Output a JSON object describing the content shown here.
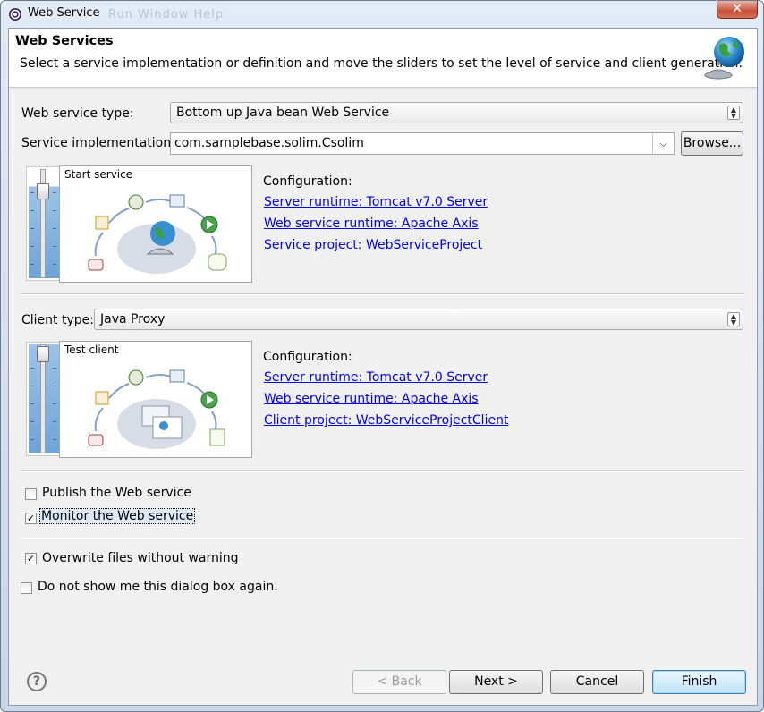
{
  "window": {
    "title": "Web Service",
    "close_glyph": "✕",
    "ghost_menu": "Run   Window   Help"
  },
  "header": {
    "title": "Web Services",
    "description": "Select a service implementation or definition and move the sliders to set the level of service and client generation.",
    "icon": "web-service-globe-icon"
  },
  "service": {
    "type_label": "Web service type:",
    "type_value": "Bottom up Java bean Web Service",
    "impl_label": "Service implementation:",
    "impl_value": "com.samplebase.solim.Csolim",
    "browse_label": "Browse...",
    "slider_caption": "Start service",
    "slider_level": 0.17,
    "config_title": "Configuration:",
    "links": [
      "Server runtime: Tomcat v7.0 Server",
      "Web service runtime: Apache Axis",
      "Service project: WebServiceProject"
    ]
  },
  "client": {
    "type_label": "Client type:",
    "type_value": "Java Proxy",
    "slider_caption": "Test client",
    "slider_level": 0.0,
    "config_title": "Configuration:",
    "links": [
      "Server runtime: Tomcat v7.0 Server",
      "Web service runtime: Apache Axis",
      "Client project: WebServiceProjectClient"
    ]
  },
  "options": {
    "publish": {
      "label": "Publish the Web service",
      "checked": false
    },
    "monitor": {
      "label": "Monitor the Web service",
      "checked": true
    },
    "overwrite": {
      "label": "Overwrite files without warning",
      "checked": true
    },
    "dont_show": {
      "label": "Do not show me this dialog box again.",
      "checked": false
    }
  },
  "footer": {
    "help": "?",
    "back": "< Back",
    "next": "Next >",
    "cancel": "Cancel",
    "finish": "Finish"
  },
  "checkmark": "✓"
}
